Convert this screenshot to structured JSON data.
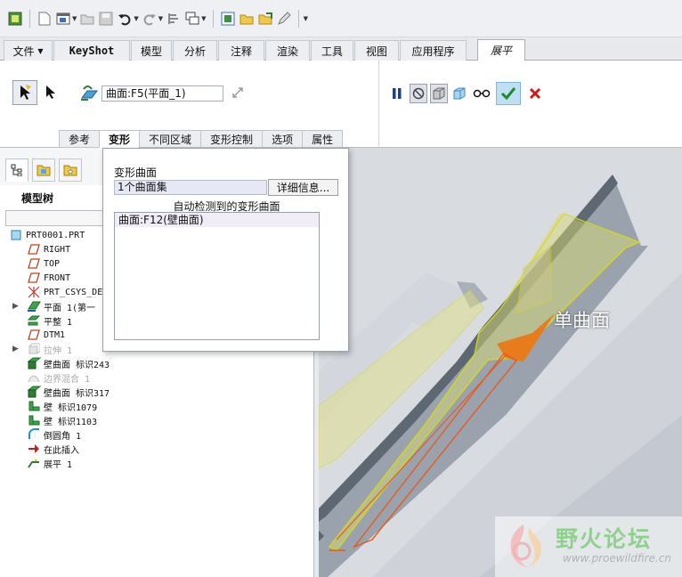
{
  "quick_access": {
    "icons": [
      "regenerate-icon",
      "new-icon",
      "window-icon",
      "open-icon",
      "save-icon",
      "undo-icon",
      "redo-icon",
      "regen-manager-icon",
      "windows-icon",
      "model-icon",
      "folder-icon",
      "export-icon",
      "edit-icon",
      "customize-icon"
    ]
  },
  "ribbon_tabs": [
    "文件",
    "KeyShot",
    "模型",
    "分析",
    "注释",
    "渲染",
    "工具",
    "视图",
    "应用程序",
    "展平"
  ],
  "active_tab": "展平",
  "ribbon": {
    "reference_field": "曲面:F5(平面_1)",
    "subtabs": [
      "参考",
      "变形",
      "不同区域",
      "变形控制",
      "选项",
      "属性"
    ],
    "active_subtab": "变形"
  },
  "left_panel": {
    "title": "模型树",
    "tree": [
      {
        "label": "PRT0001.PRT",
        "icon": "part-icon",
        "dim": false,
        "expand": false
      },
      {
        "label": "RIGHT",
        "icon": "plane-icon",
        "dim": false,
        "expand": false
      },
      {
        "label": "TOP",
        "icon": "plane-icon",
        "dim": false,
        "expand": false
      },
      {
        "label": "FRONT",
        "icon": "plane-icon",
        "dim": false,
        "expand": false
      },
      {
        "label": "PRT_CSYS_DEF",
        "icon": "csys-icon",
        "dim": false,
        "expand": false
      },
      {
        "label": "平面 1(第一",
        "icon": "sheetmetal-plane-icon",
        "dim": false,
        "expand": true
      },
      {
        "label": "平整 1",
        "icon": "flat-icon",
        "dim": false,
        "expand": false
      },
      {
        "label": "DTM1",
        "icon": "plane-icon",
        "dim": false,
        "expand": false
      },
      {
        "label": "拉伸 1",
        "icon": "extrude-icon",
        "dim": true,
        "expand": true
      },
      {
        "label": "壁曲面 标识243",
        "icon": "wall-surface-icon",
        "dim": false,
        "expand": false
      },
      {
        "label": "边界混合 1",
        "icon": "boundary-blend-icon",
        "dim": true,
        "expand": false
      },
      {
        "label": "壁曲面 标识317",
        "icon": "wall-surface-icon",
        "dim": false,
        "expand": false
      },
      {
        "label": "壁 标识1079",
        "icon": "wall-icon",
        "dim": false,
        "expand": false
      },
      {
        "label": "壁 标识1103",
        "icon": "wall-icon",
        "dim": false,
        "expand": false
      },
      {
        "label": "倒圆角 1",
        "icon": "round-icon",
        "dim": false,
        "expand": false
      },
      {
        "label": "在此插入",
        "icon": "insert-here-icon",
        "dim": false,
        "expand": false
      },
      {
        "label": "展平 1",
        "icon": "flatten-icon",
        "dim": false,
        "expand": false
      }
    ]
  },
  "popup": {
    "deform_label": "变形曲面",
    "collector_value": "1个曲面集",
    "details_button": "详细信息...",
    "auto_label": "自动检测到的变形曲面",
    "auto_items": [
      "曲面:F12(壁曲面)"
    ]
  },
  "viewport": {
    "callout": "单曲面"
  },
  "watermark": {
    "title": "野火论坛",
    "url": "www.proewildfire.cn"
  }
}
